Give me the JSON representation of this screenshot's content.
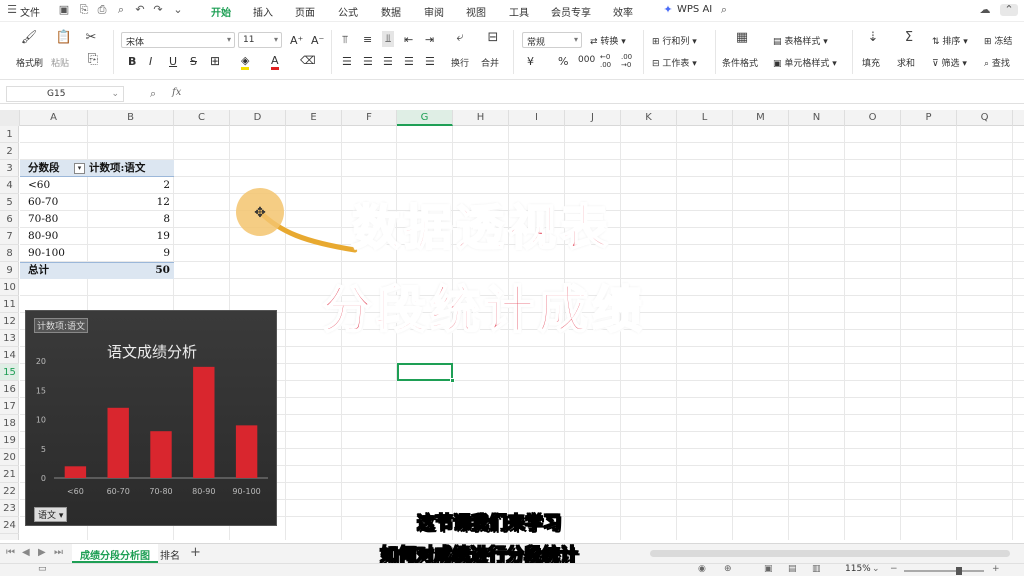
{
  "menubar": {
    "file": "文件",
    "tabs": [
      "开始",
      "插入",
      "页面",
      "公式",
      "数据",
      "审阅",
      "视图",
      "工具",
      "会员专享",
      "效率"
    ],
    "active_tab": "开始",
    "wps_ai": "WPS AI"
  },
  "ribbon": {
    "format_painter": "格式刷",
    "paste": "粘贴",
    "font_name": "宋体",
    "font_size": "11",
    "number_format": "常规",
    "convert": "转换",
    "wrap": "换行",
    "merge": "合并",
    "row_col": "行和列",
    "worksheet": "工作表",
    "cond_format": "条件格式",
    "table_style": "表格样式",
    "cell_style": "单元格样式",
    "fill": "填充",
    "sum": "求和",
    "sort": "排序",
    "filter": "筛选",
    "freeze": "冻结",
    "find": "查找"
  },
  "formula_bar": {
    "name_box": "G15",
    "fx": "fx",
    "value": ""
  },
  "columns": [
    "A",
    "B",
    "C",
    "D",
    "E",
    "F",
    "G",
    "H",
    "I",
    "J",
    "K",
    "L",
    "M",
    "N",
    "O",
    "P",
    "Q"
  ],
  "active_column": "G",
  "rows": [
    "1",
    "2",
    "3",
    "4",
    "5",
    "6",
    "7",
    "8",
    "9",
    "10",
    "11",
    "12",
    "13",
    "14",
    "15",
    "16",
    "17",
    "18",
    "19",
    "20",
    "21",
    "22",
    "23",
    "24"
  ],
  "active_row": "15",
  "pivot": {
    "header_a": "分数段",
    "header_b": "计数项:语文",
    "items": [
      {
        "label": "<60",
        "value": "2"
      },
      {
        "label": "60-70",
        "value": "12"
      },
      {
        "label": "70-80",
        "value": "8"
      },
      {
        "label": "80-90",
        "value": "19"
      },
      {
        "label": "90-100",
        "value": "9"
      }
    ],
    "total_label": "总计",
    "total_value": "50"
  },
  "chart_data": {
    "type": "bar",
    "title": "语文成绩分析",
    "field_tag": "计数项:语文",
    "filter_button": "语文",
    "categories": [
      "<60",
      "60-70",
      "70-80",
      "80-90",
      "90-100"
    ],
    "values": [
      2,
      12,
      8,
      19,
      9
    ],
    "y_ticks": [
      "0",
      "5",
      "10",
      "15",
      "20"
    ],
    "ylim": [
      0,
      20
    ],
    "bar_color": "#d9262e",
    "background": "#2f2f2f",
    "grid": false
  },
  "overlay": {
    "title_line1": "数据透视表",
    "title_line2": "分段统计成绩",
    "subtitle_line1": "这节课我们来学习",
    "subtitle_line2": "如何对成绩进行分段统计"
  },
  "sheet_tabs": {
    "tabs": [
      "成绩分段分析图",
      "排名"
    ],
    "active": "成绩分段分析图",
    "add": "+"
  },
  "status": {
    "zoom": "115%"
  },
  "colors": {
    "accent": "#1e9f55",
    "overlay_red": "#e0364b",
    "pivot_header_bg": "#dce6f1"
  }
}
